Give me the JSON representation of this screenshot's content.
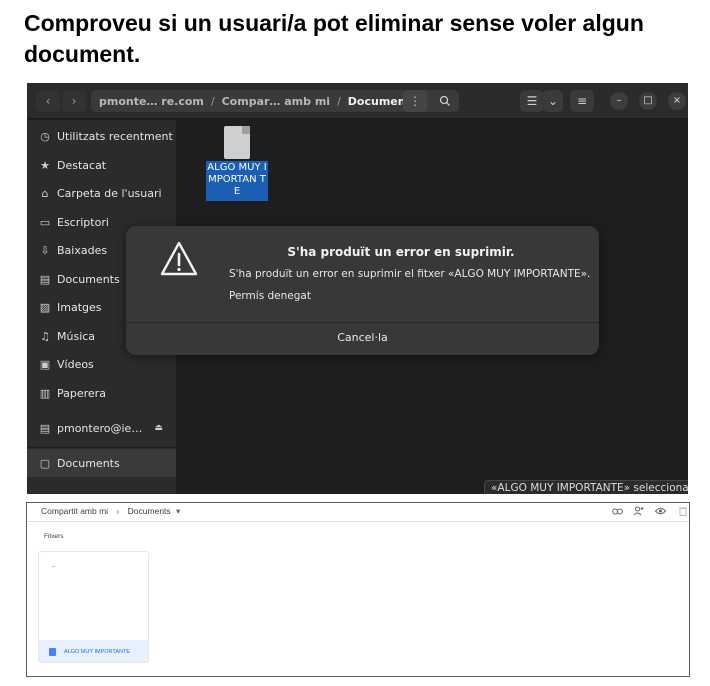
{
  "heading": "Comproveu si un usuari/a pot eliminar sense voler algun document.",
  "file_manager": {
    "header": {
      "back_icon": "chevron-left-icon",
      "forward_icon": "chevron-right-icon",
      "path_segments": [
        "pmonte… re.com",
        "Compar… amb mi",
        "Documents"
      ],
      "path_sep": "/",
      "menu_icon": "vertical-dots-icon",
      "search_icon": "search-icon",
      "view_icon": "list-view-icon",
      "dropdown_icon": "chevron-down-icon",
      "hamburger_icon": "hamburger-icon",
      "minimize": "–",
      "maximize": "□",
      "close": "×"
    },
    "sidebar": [
      {
        "label": "Utilitzats recentment",
        "icon": "clock-icon",
        "glyph": "◷"
      },
      {
        "label": "Destacat",
        "icon": "star-icon",
        "glyph": "★"
      },
      {
        "label": "Carpeta de l'usuari",
        "icon": "home-icon",
        "glyph": "⌂"
      },
      {
        "label": "Escriptori",
        "icon": "desktop-icon",
        "glyph": "▭"
      },
      {
        "label": "Baixades",
        "icon": "download-icon",
        "glyph": "⇩"
      },
      {
        "label": "Documents",
        "icon": "document-icon",
        "glyph": "▤"
      },
      {
        "label": "Imatges",
        "icon": "image-icon",
        "glyph": "▨"
      },
      {
        "label": "Música",
        "icon": "music-icon",
        "glyph": "♫"
      },
      {
        "label": "Vídeos",
        "icon": "video-icon",
        "glyph": "▣"
      },
      {
        "label": "Paperera",
        "icon": "trash-icon",
        "glyph": "▥"
      },
      {
        "label": "pmontero@ie…",
        "icon": "drive-icon",
        "glyph": "▤",
        "eject": "⏏"
      },
      {
        "label": "Documents",
        "icon": "folder-icon",
        "glyph": "▢",
        "active": true
      }
    ],
    "file": {
      "name": "ALGO MUY IMPORTANTE",
      "display": "ALGO MUY IMPORTAN TE"
    },
    "dialog": {
      "title": "S'ha produït un error en suprimir.",
      "message": "S'ha produït un error en suprimir el fitxer «ALGO MUY IMPORTANTE».",
      "detail": "Permís denegat",
      "button": "Cancel·la"
    },
    "status": "«ALGO MUY IMPORTANTE» seleccionat"
  },
  "drive": {
    "breadcrumb": [
      "Compartit amb mi",
      "Documents"
    ],
    "breadcrumb_sep": "›",
    "dropdown": "▾",
    "actions": [
      "link-icon",
      "add-person-icon",
      "eye-icon",
      "trash-icon"
    ],
    "section": "Fitxers",
    "file_name": "ALGO MUY IMPORTANTE"
  },
  "colors": {
    "selection": "#1a5fb4",
    "drive_link": "#1a73e8",
    "doc_icon": "#4285f4"
  }
}
